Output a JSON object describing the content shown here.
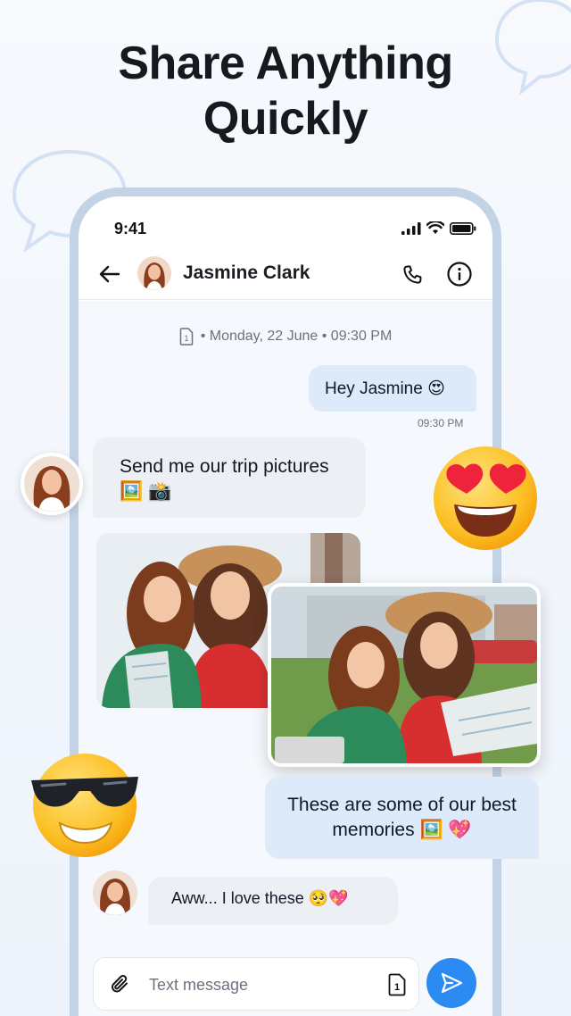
{
  "headline": {
    "line1": "Share Anything",
    "line2": "Quickly"
  },
  "status_bar": {
    "time": "9:41"
  },
  "chat_header": {
    "contact_name": "Jasmine Clark"
  },
  "date_separator": {
    "text": "• Monday, 22 June • 09:30 PM"
  },
  "messages": [
    {
      "direction": "out",
      "text": "Hey Jasmine 😍",
      "time": "09:30 PM"
    },
    {
      "direction": "in",
      "text": "Send me our trip pictures 🖼️ 📸"
    },
    {
      "direction": "out",
      "text": "These are some of our best memories 🖼️ 💖"
    },
    {
      "direction": "in",
      "text": "Aww... I love these 🥺💖"
    }
  ],
  "composer": {
    "placeholder": "Text message"
  },
  "colors": {
    "accent": "#2b8bf2",
    "outgoing_bubble": "#dceaf9",
    "incoming_bubble": "#eceff3",
    "phone_frame": "#c3d3e6"
  },
  "icons": [
    "back-arrow-icon",
    "phone-icon",
    "info-icon",
    "document-icon",
    "paperclip-icon",
    "send-icon",
    "signal-icon",
    "wifi-icon",
    "battery-icon"
  ]
}
